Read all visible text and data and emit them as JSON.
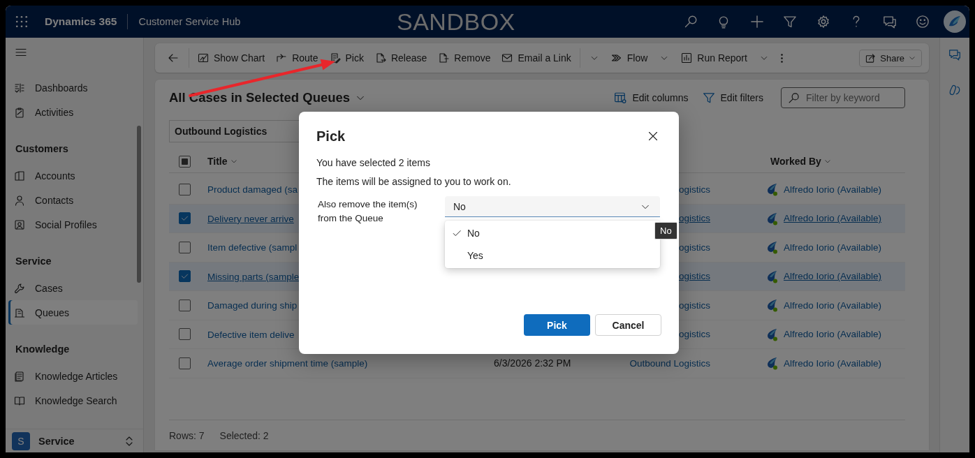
{
  "top_bar": {
    "app_name": "Dynamics 365",
    "area_name": "Customer Service Hub",
    "environment": "SANDBOX"
  },
  "sidebar": {
    "sections": [
      {
        "items": [
          {
            "label": "Dashboards",
            "selected": false
          },
          {
            "label": "Activities",
            "selected": false
          }
        ]
      },
      {
        "heading": "Customers",
        "items": [
          {
            "label": "Accounts",
            "selected": false
          },
          {
            "label": "Contacts",
            "selected": false
          },
          {
            "label": "Social Profiles",
            "selected": false
          }
        ]
      },
      {
        "heading": "Service",
        "items": [
          {
            "label": "Cases",
            "selected": false
          },
          {
            "label": "Queues",
            "selected": true
          }
        ]
      },
      {
        "heading": "Knowledge",
        "items": [
          {
            "label": "Knowledge Articles",
            "selected": false
          },
          {
            "label": "Knowledge Search",
            "selected": false
          }
        ]
      }
    ],
    "area_switcher": {
      "initial": "S",
      "label": "Service"
    }
  },
  "command_bar": {
    "items": [
      {
        "kind": "back"
      },
      {
        "kind": "button",
        "label": "Show Chart"
      },
      {
        "kind": "button",
        "label": "Route"
      },
      {
        "kind": "button",
        "label": "Pick"
      },
      {
        "kind": "button",
        "label": "Release"
      },
      {
        "kind": "button",
        "label": "Remove"
      },
      {
        "kind": "button",
        "label": "Email a Link"
      },
      {
        "kind": "split-menu"
      },
      {
        "kind": "menu-button",
        "label": "Flow"
      },
      {
        "kind": "menu-button",
        "label": "Run Report"
      },
      {
        "kind": "more"
      }
    ],
    "share": {
      "label": "Share"
    }
  },
  "view": {
    "title": "All Cases in Selected Queues",
    "actions": [
      "Edit columns",
      "Edit filters"
    ],
    "search": {
      "placeholder": "Filter by keyword"
    },
    "filter_value": "Outbound Logistics"
  },
  "table": {
    "select_all_mixed": true,
    "columns": [
      {
        "label": "Title"
      },
      {
        "label": "Worked By"
      }
    ],
    "rows": [
      {
        "title": "Product damaged (sa",
        "selected": false,
        "queue": "ogistics",
        "worked_by": "Alfredo Iorio (Available)"
      },
      {
        "title": "Delivery never arrive",
        "selected": true,
        "queue": "ogistics",
        "worked_by": "Alfredo Iorio (Available)"
      },
      {
        "title": "Item defective (sampl",
        "selected": false,
        "queue": "ogistics",
        "worked_by": "Alfredo Iorio (Available)"
      },
      {
        "title": "Missing parts (sample",
        "selected": true,
        "queue": "ogistics",
        "worked_by": "Alfredo Iorio (Available)"
      },
      {
        "title": "Damaged during ship",
        "selected": false,
        "queue": "ogistics",
        "worked_by": "Alfredo Iorio (Available)"
      },
      {
        "title": "Defective item delive",
        "selected": false,
        "queue": "ogistics",
        "worked_by": "Alfredo Iorio (Available)"
      },
      {
        "title": "Average order shipment time (sample)",
        "selected": false,
        "created": "6/3/2026 2:32 PM",
        "queue": "Outbound Logistics",
        "worked_by": "Alfredo Iorio (Available)"
      }
    ],
    "footer": {
      "rows": "Rows: 7",
      "selected": "Selected: 2"
    }
  },
  "dialog": {
    "title": "Pick",
    "lines": [
      "You have selected 2 items",
      "The items will be assigned to you to work on."
    ],
    "field": {
      "label": "Also remove the item(s) from the Queue",
      "value": "No",
      "expanded": true,
      "options": [
        {
          "label": "No",
          "selected": true
        },
        {
          "label": "Yes",
          "selected": false
        }
      ]
    },
    "tooltip": "No",
    "buttons": [
      {
        "label": "Pick",
        "primary": true
      },
      {
        "label": "Cancel",
        "primary": false
      }
    ]
  }
}
